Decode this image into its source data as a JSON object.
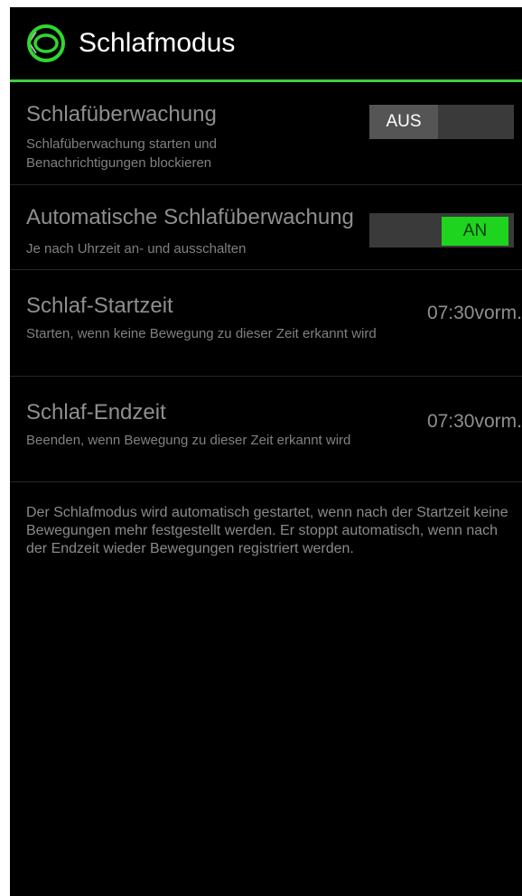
{
  "header": {
    "back_glyph": "〈",
    "title": "Schlafmodus",
    "logo_icon": "ring-logo-icon"
  },
  "settings": {
    "sleep_tracking": {
      "title": "Schlafüberwachung",
      "subtitle": "Schlafüberwachung starten und Benachrichtigungen blockieren",
      "toggle_label": "AUS",
      "state": "off"
    },
    "auto_sleep_tracking": {
      "title": "Automatische Schlafüberwachung",
      "subtitle": "Je nach Uhrzeit an- und ausschalten",
      "toggle_label": "AN",
      "state": "on"
    },
    "start_time": {
      "title": "Schlaf-Startzeit",
      "subtitle": "Starten, wenn keine Bewegung zu dieser Zeit erkannt wird",
      "value": "07:30vorm."
    },
    "end_time": {
      "title": "Schlaf-Endzeit",
      "subtitle": "Beenden, wenn Bewegung zu dieser Zeit erkannt wird",
      "value": "07:30vorm."
    }
  },
  "info": "Der Schlafmodus wird automatisch gestartet, wenn nach der Startzeit keine Bewegungen mehr festgestellt werden. Er stoppt automatisch, wenn nach der Endzeit wieder Bewegungen registriert werden.",
  "colors": {
    "accent": "#3fce3f",
    "toggle_on": "#1fd41f",
    "background": "#000000"
  }
}
